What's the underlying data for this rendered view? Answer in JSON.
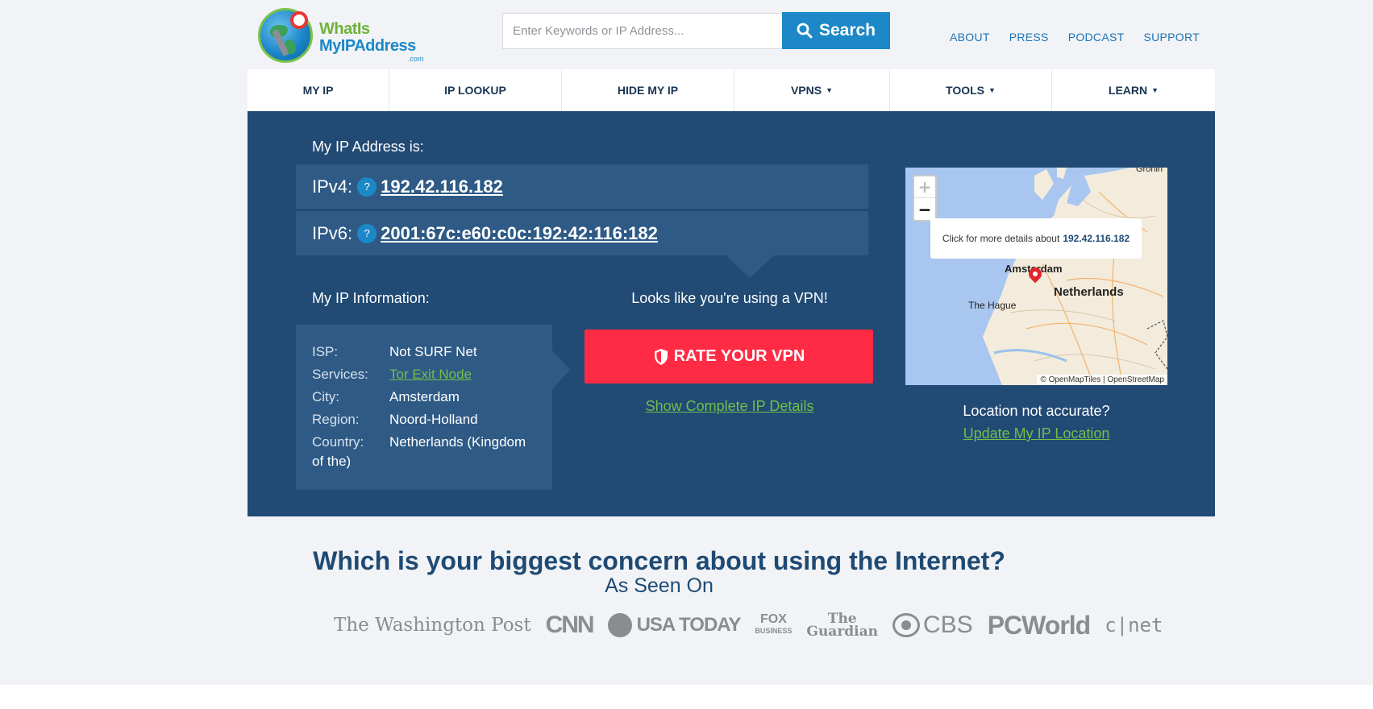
{
  "logo": {
    "line1": "WhatIs",
    "line2": "MyIPAddress",
    "line3": ".com"
  },
  "search": {
    "placeholder": "Enter Keywords or IP Address...",
    "button_label": "Search"
  },
  "top_links": [
    "ABOUT",
    "PRESS",
    "PODCAST",
    "SUPPORT"
  ],
  "nav": [
    {
      "label": "MY IP",
      "caret": ""
    },
    {
      "label": "IP LOOKUP",
      "caret": ""
    },
    {
      "label": "HIDE MY IP",
      "caret": ""
    },
    {
      "label": "VPNS",
      "caret": "▼"
    },
    {
      "label": "TOOLS",
      "caret": "▼"
    },
    {
      "label": "LEARN",
      "caret": "▼"
    }
  ],
  "hero": {
    "ip_heading": "My IP Address is:",
    "ipv4_label": "IPv4:",
    "ipv4_value": "192.42.116.182",
    "ipv6_label": "IPv6:",
    "ipv6_value": "2001:67c:e60:c0c:192:42:116:182",
    "help_glyph": "?",
    "info_heading": "My IP Information:",
    "info": {
      "isp_label": "ISP:",
      "isp_value": "Not SURF Net",
      "services_label": "Services:",
      "services_value": "Tor Exit Node",
      "city_label": "City:",
      "city_value": "Amsterdam",
      "region_label": "Region:",
      "region_value": "Noord-Holland",
      "country_label": "Country:",
      "country_value": "Netherlands (Kingdom",
      "country_value_cont": "of the)"
    },
    "vpn_notice": "Looks like you're using a VPN!",
    "rate_button": "RATE YOUR VPN",
    "show_details": "Show Complete IP Details"
  },
  "map": {
    "zoom_in": "+",
    "zoom_out": "−",
    "popup_text": "Click for more details about",
    "popup_ip": "192.42.116.182",
    "labels": {
      "amsterdam": "Amsterdam",
      "netherlands": "Netherlands",
      "hague": "The Hague",
      "groningen": "Gronin"
    },
    "attribution": "© OpenMapTiles | OpenStreetMap",
    "location_question": "Location not accurate?",
    "update_link": "Update My IP Location"
  },
  "concern_heading": "Which is your biggest concern about using the Internet?",
  "seen_on": "As Seen On",
  "press": {
    "washington_post": "The Washington Post",
    "cnn": "CNN",
    "usa_today": "USA TODAY",
    "fox": "FOX",
    "fox_sub": "BUSINESS",
    "guardian_1": "The",
    "guardian_2": "Guardian",
    "cbs": "CBS",
    "pcworld": "PCWorld",
    "cnet": "c|net"
  },
  "colors": {
    "brand_blue": "#1c88c7",
    "hero_bg": "#214a74",
    "panel_bg": "#2e5a85",
    "cta_red": "#ff2b45",
    "link_green": "#6fbf4a"
  }
}
